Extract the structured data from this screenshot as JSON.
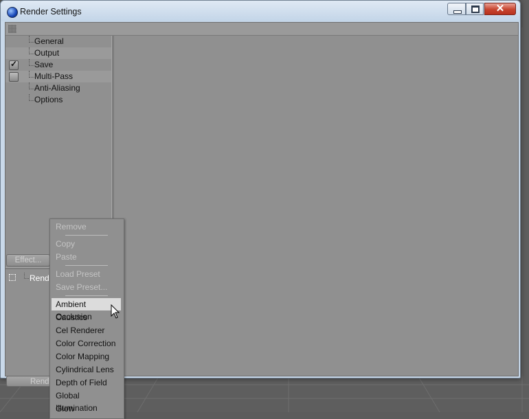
{
  "window": {
    "title": "Render Settings",
    "close_glyph": "✕"
  },
  "settings_tree": {
    "items": [
      {
        "label": "General"
      },
      {
        "label": "Output"
      },
      {
        "label": "Save",
        "checkbox": "checked"
      },
      {
        "label": "Multi-Pass",
        "checkbox": "unchecked"
      },
      {
        "label": "Anti-Aliasing"
      },
      {
        "label": "Options"
      }
    ]
  },
  "effect_button": {
    "label": "Effect..."
  },
  "render_list": {
    "item_label": "Rende",
    "button_label": "Rende"
  },
  "context_menu": {
    "items": [
      {
        "label": "Remove",
        "enabled": false
      },
      {
        "label": "Copy",
        "enabled": false
      },
      {
        "label": "Paste",
        "enabled": false
      },
      {
        "label": "Load Preset",
        "enabled": false
      },
      {
        "label": "Save Preset...",
        "enabled": false
      },
      {
        "label": "Ambient Occlusion",
        "enabled": true,
        "highlighted": true
      },
      {
        "label": "Caustics",
        "enabled": true
      },
      {
        "label": "Cel Renderer",
        "enabled": true
      },
      {
        "label": "Color Correction",
        "enabled": true
      },
      {
        "label": "Color Mapping",
        "enabled": true
      },
      {
        "label": "Cylindrical Lens",
        "enabled": true
      },
      {
        "label": "Depth of Field",
        "enabled": true
      },
      {
        "label": "Global Illumination",
        "enabled": true
      },
      {
        "label": "Glow",
        "enabled": true
      }
    ]
  },
  "colors": {
    "client_bg": "#909090",
    "disabled_text": "#c4c4c4",
    "highlight": "#dcdcdc",
    "close_button": "#c7442f"
  }
}
